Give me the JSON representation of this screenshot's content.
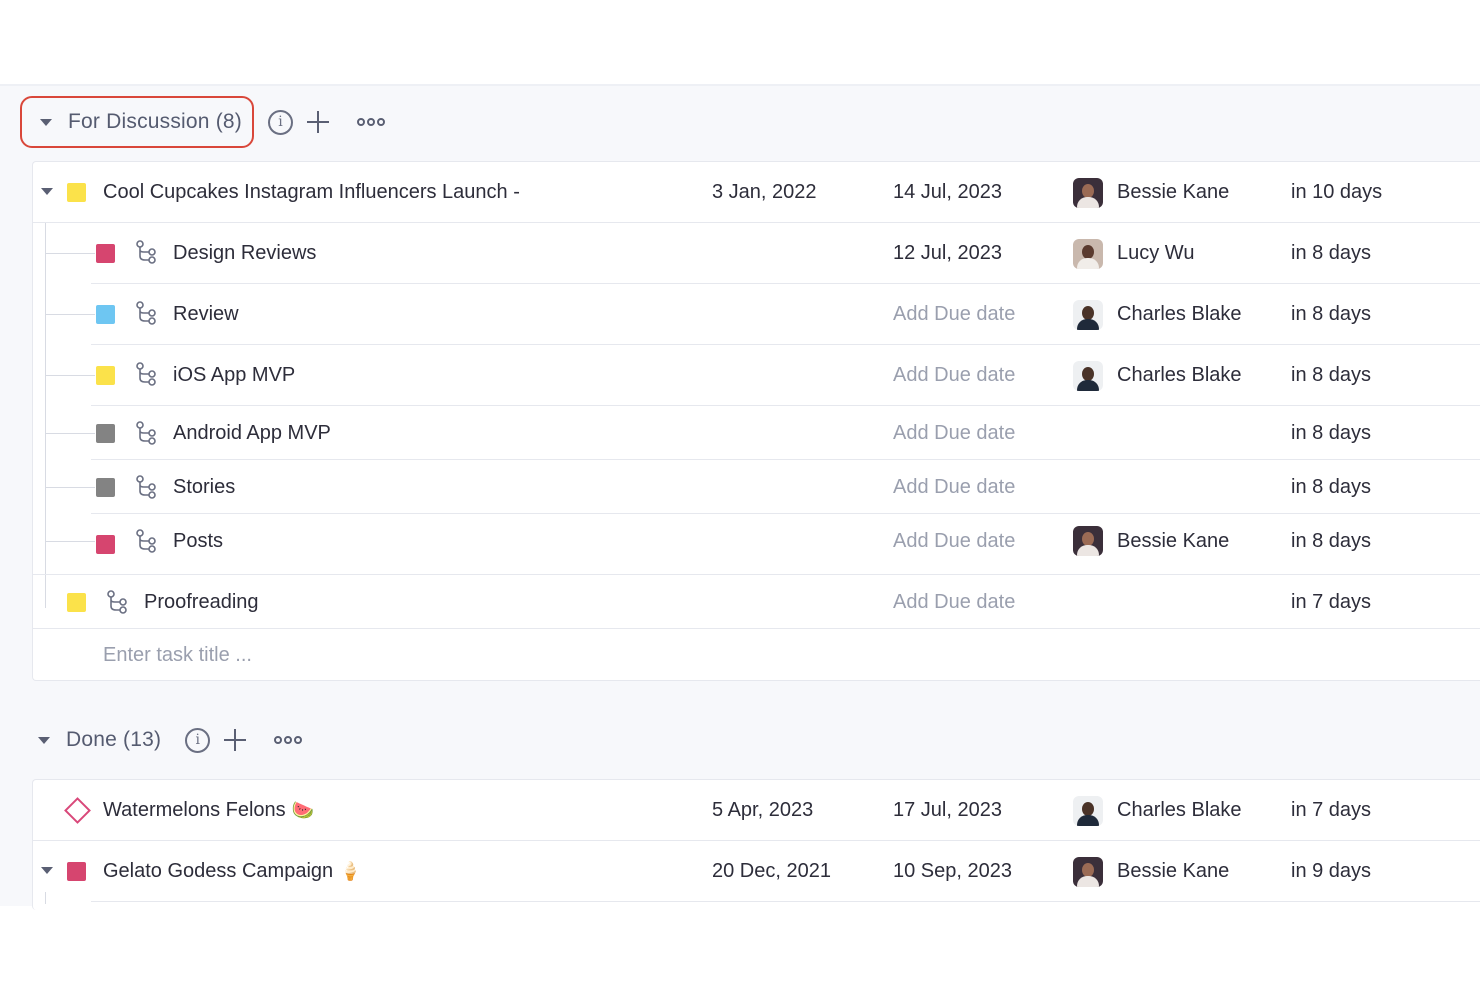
{
  "colors": {
    "yellow": "#fbe24a",
    "pink": "#d6456f",
    "blue": "#6ec6f2",
    "gray": "#838383",
    "highlight": "#d9473a"
  },
  "groups": [
    {
      "title": "For Discussion (8)",
      "highlighted": true,
      "tasks": [
        {
          "title": "Cool Cupcakes Instagram Influencers Launch -",
          "start": "3 Jan, 2022",
          "due": "14 Jul, 2023",
          "assignee": "Bessie Kane",
          "remaining": "in 10 days",
          "color": "yellow",
          "parent": true
        },
        {
          "title": "Design Reviews",
          "start": "",
          "due": "12 Jul, 2023",
          "assignee": "Lucy Wu",
          "remaining": "in 8 days",
          "color": "pink",
          "subtask": true
        },
        {
          "title": "Review",
          "start": "",
          "due": "Add Due date",
          "assignee": "Charles Blake",
          "remaining": "in 8 days",
          "color": "blue",
          "subtask": true
        },
        {
          "title": "iOS App MVP",
          "start": "",
          "due": "Add Due date",
          "assignee": "Charles Blake",
          "remaining": "in 8 days",
          "color": "yellow",
          "subtask": true
        },
        {
          "title": "Android App MVP",
          "start": "",
          "due": "Add Due date",
          "assignee": "",
          "remaining": "in 8 days",
          "color": "gray",
          "subtask": true
        },
        {
          "title": "Stories",
          "start": "",
          "due": "Add Due date",
          "assignee": "",
          "remaining": "in 8 days",
          "color": "gray",
          "subtask": true
        },
        {
          "title": "Posts",
          "start": "",
          "due": "Add Due date",
          "assignee": "Bessie Kane",
          "remaining": "in 8 days",
          "color": "pink",
          "subtask": true
        },
        {
          "title": "Proofreading",
          "start": "",
          "due": "Add Due date",
          "assignee": "",
          "remaining": "in 7 days",
          "color": "yellow",
          "subtask": false
        }
      ],
      "enter_placeholder": "Enter task title ..."
    },
    {
      "title": "Done (13)",
      "highlighted": false,
      "tasks": [
        {
          "title": "Watermelons Felons",
          "emoji": "🍉",
          "start": "5 Apr, 2023",
          "due": "17 Jul, 2023",
          "assignee": "Charles Blake",
          "remaining": "in 7 days",
          "shape": "diamond"
        },
        {
          "title": "Gelato Godess Campaign",
          "emoji": "🍦",
          "start": "20 Dec, 2021",
          "due": "10 Sep, 2023",
          "assignee": "Bessie Kane",
          "remaining": "in 9 days",
          "color": "pink",
          "parent": true
        }
      ]
    }
  ],
  "icons": {
    "info": "i",
    "group_toggle": "caret-down-icon",
    "add": "plus-icon",
    "more": "more-icon",
    "subtask": "subtask-icon"
  }
}
